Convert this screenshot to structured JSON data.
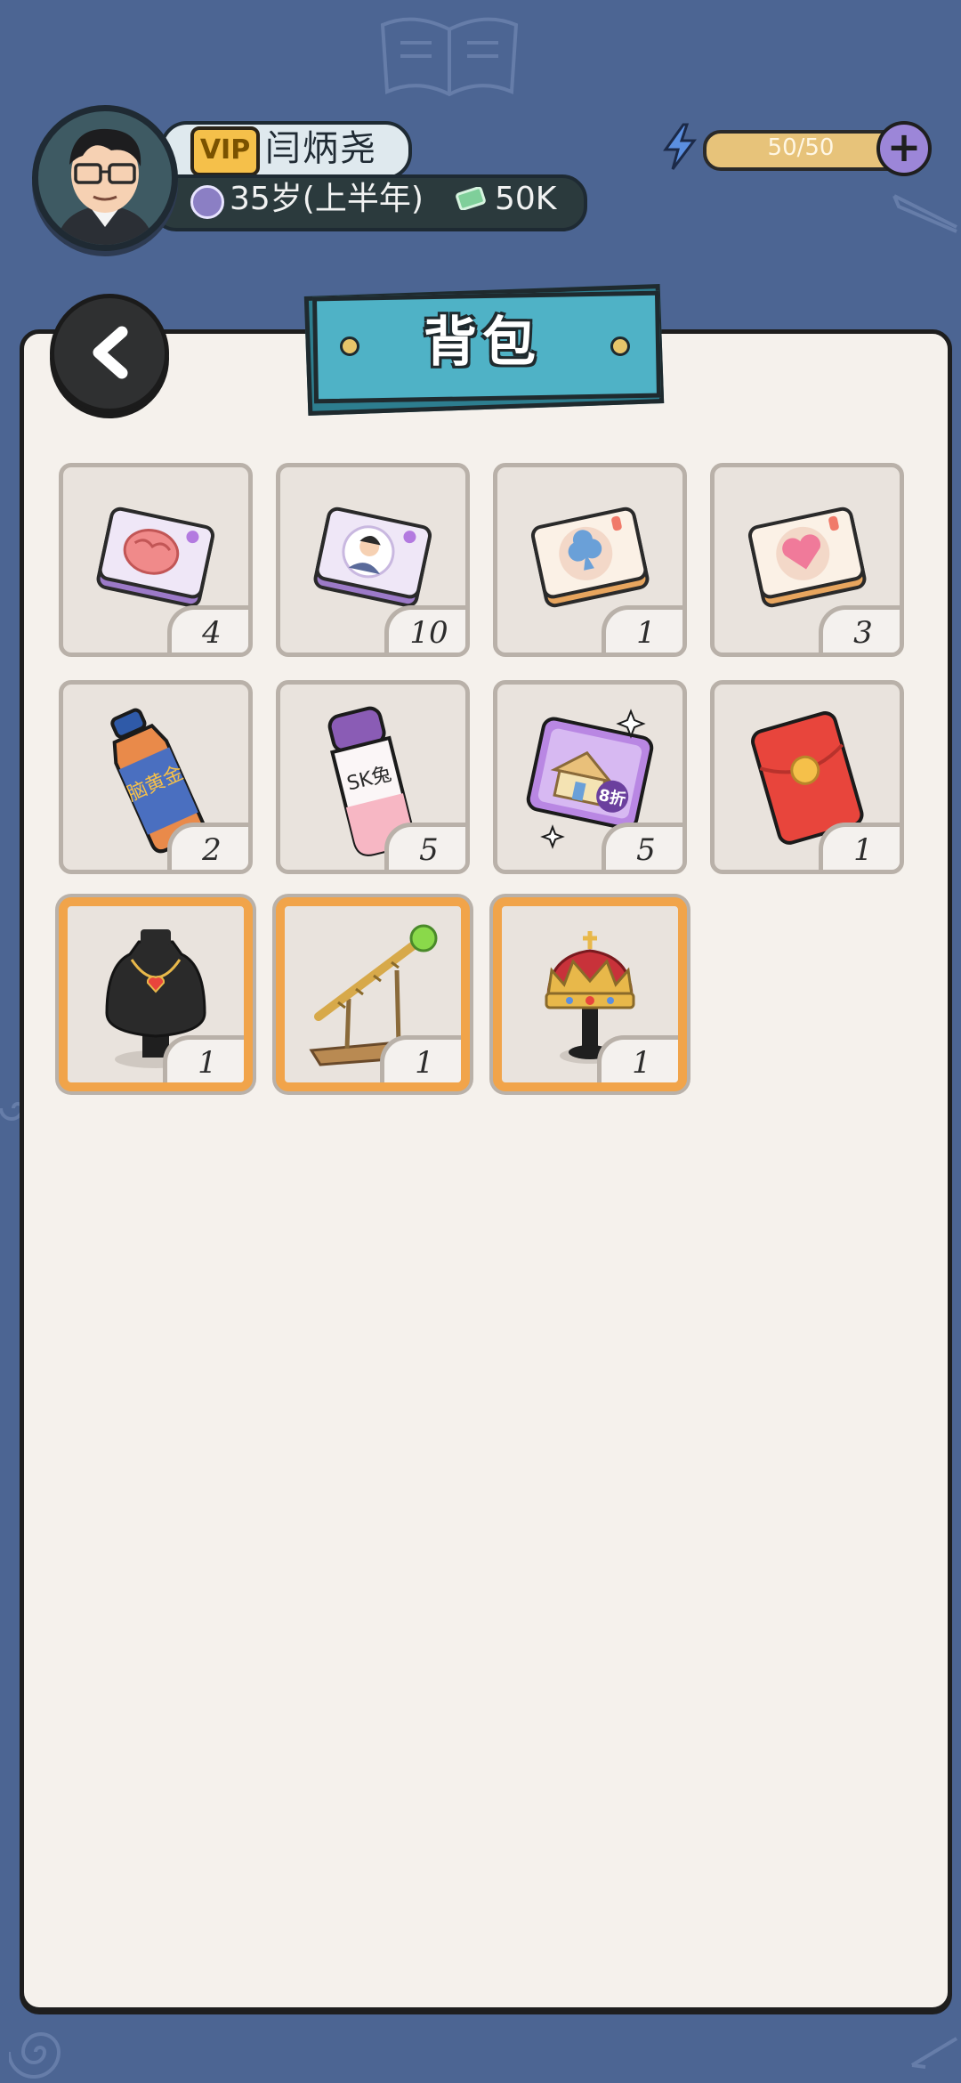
{
  "player": {
    "vip_label": "VIP",
    "name": "闫炳尧",
    "age": "35岁(上半年)",
    "cash": "50K"
  },
  "energy": {
    "value": "50/50",
    "fill_fraction": 1.0
  },
  "panel": {
    "title": "背包"
  },
  "items": [
    {
      "icon": "brain-card-icon",
      "count": "4"
    },
    {
      "icon": "portrait-card-icon",
      "count": "10"
    },
    {
      "icon": "club-card-icon",
      "count": "1"
    },
    {
      "icon": "heart-card-icon",
      "count": "3"
    },
    {
      "icon": "brain-gold-bottle-icon",
      "label": "脑黄金",
      "count": "2"
    },
    {
      "icon": "sk-bottle-icon",
      "label": "SK兔",
      "count": "5"
    },
    {
      "icon": "house-discount-card-icon",
      "label": "8折",
      "count": "5"
    },
    {
      "icon": "red-envelope-icon",
      "count": "1"
    },
    {
      "icon": "necklace-display-icon",
      "count": "1"
    },
    {
      "icon": "scepter-display-icon",
      "count": "1"
    },
    {
      "icon": "crown-display-icon",
      "count": "1"
    }
  ],
  "colors": {
    "background": "#4c6593",
    "panel": "#f5f1ec",
    "title_banner": "#4fb2c6",
    "slot_border": "#b9b1a9",
    "rare_border": "#f1a44a",
    "vip_gold": "#f5c04a",
    "energy_bar": "#e7c37a"
  }
}
